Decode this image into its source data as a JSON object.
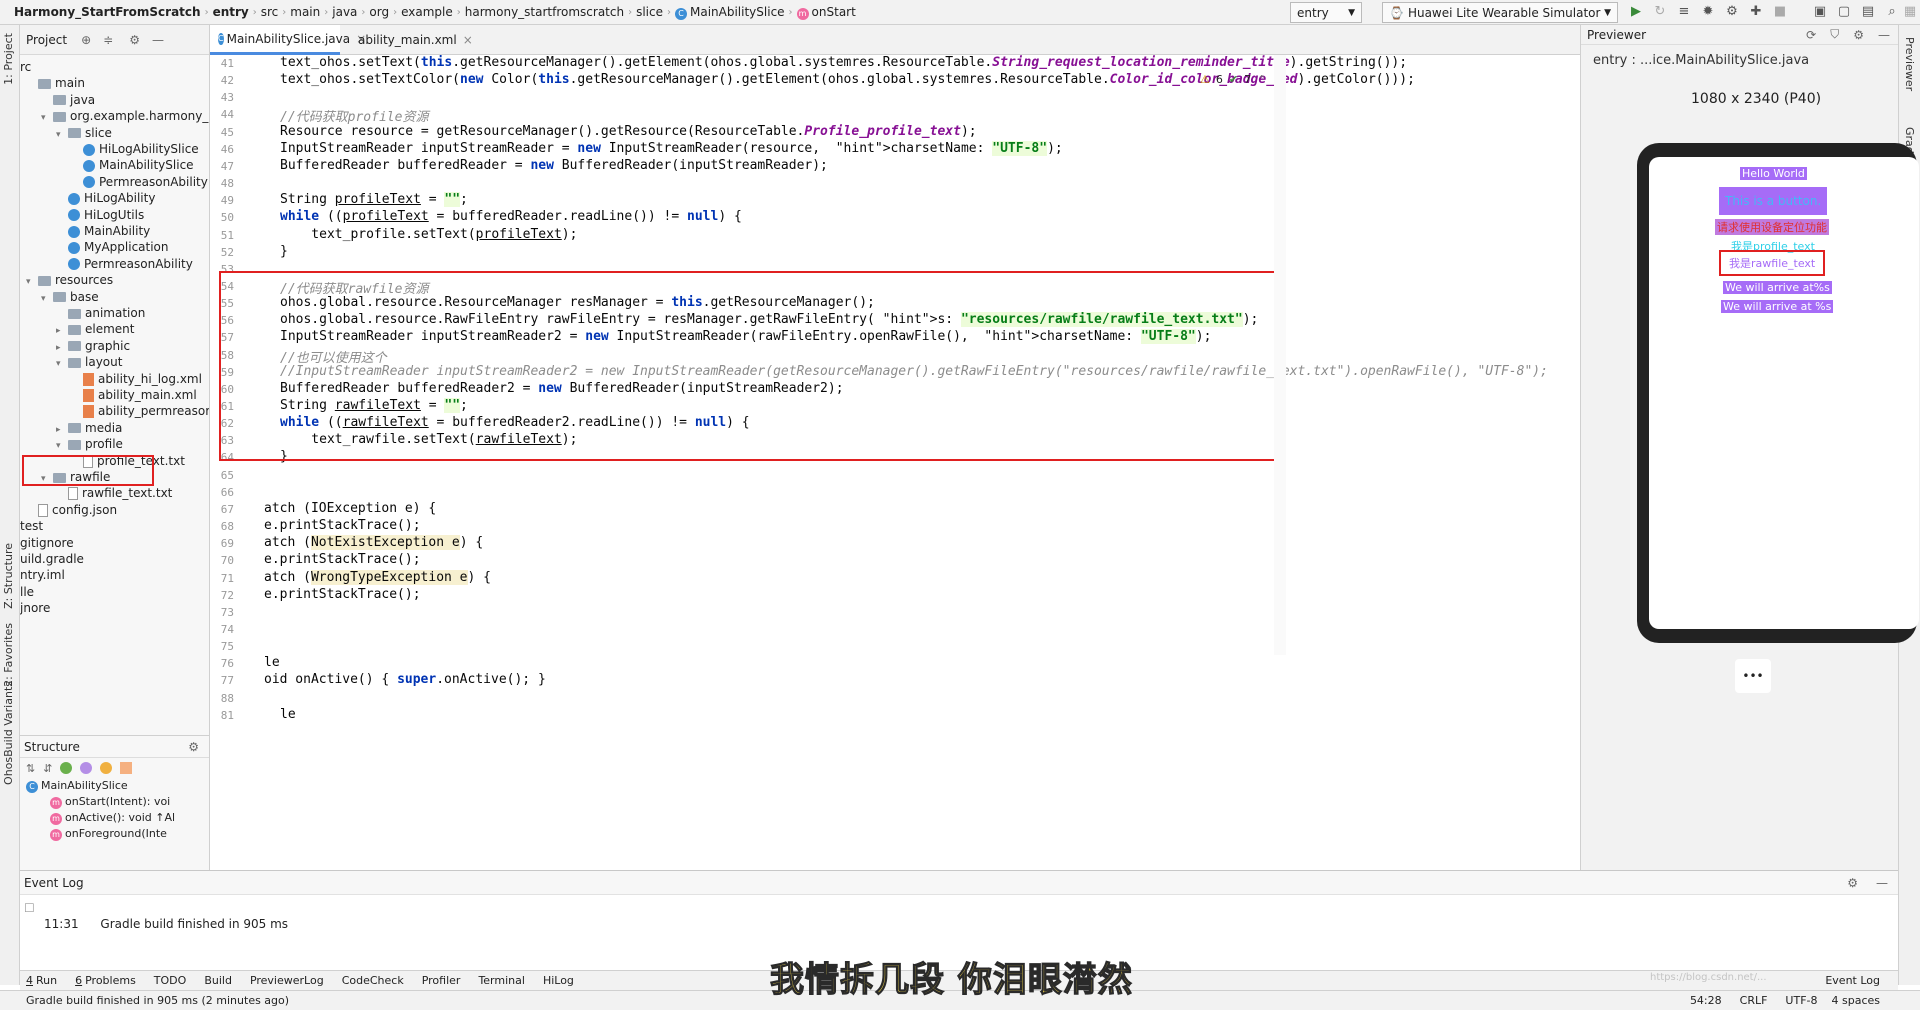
{
  "breadcrumb": [
    "Harmony_StartFromScratch",
    "entry",
    "src",
    "main",
    "java",
    "org",
    "example",
    "harmony_startfromscratch",
    "slice",
    "MainAbilitySlice",
    "onStart"
  ],
  "toolbar": {
    "config": "entry",
    "device": "Huawei Lite Wearable Simulator"
  },
  "left_tabs": {
    "project": "1: Project",
    "structure": "Z: Structure",
    "favorites": "2: Favorites",
    "ohos": "OhosBuild Variants"
  },
  "right_tabs": {
    "previewer": "Previewer",
    "gradle": "Gradle"
  },
  "project": {
    "title": "Project",
    "nodes": [
      {
        "label": "rc",
        "icon": "none",
        "indent": 0,
        "arrow": ""
      },
      {
        "label": "main",
        "icon": "folder",
        "indent": 0,
        "arrow": ""
      },
      {
        "label": "java",
        "icon": "folder",
        "indent": 1,
        "arrow": ""
      },
      {
        "label": "org.example.harmony_st",
        "icon": "folder",
        "indent": 1,
        "arrow": "down"
      },
      {
        "label": "slice",
        "icon": "folder",
        "indent": 2,
        "arrow": "down"
      },
      {
        "label": "HiLogAbilitySlice",
        "icon": "class",
        "indent": 3,
        "arrow": ""
      },
      {
        "label": "MainAbilitySlice",
        "icon": "class",
        "indent": 3,
        "arrow": ""
      },
      {
        "label": "PermreasonAbility",
        "icon": "class",
        "indent": 3,
        "arrow": ""
      },
      {
        "label": "HiLogAbility",
        "icon": "class",
        "indent": 2,
        "arrow": ""
      },
      {
        "label": "HiLogUtils",
        "icon": "class",
        "indent": 2,
        "arrow": ""
      },
      {
        "label": "MainAbility",
        "icon": "class",
        "indent": 2,
        "arrow": ""
      },
      {
        "label": "MyApplication",
        "icon": "class",
        "indent": 2,
        "arrow": ""
      },
      {
        "label": "PermreasonAbility",
        "icon": "class",
        "indent": 2,
        "arrow": ""
      },
      {
        "label": "resources",
        "icon": "folder",
        "indent": 0,
        "arrow": "down"
      },
      {
        "label": "base",
        "icon": "folder",
        "indent": 1,
        "arrow": "down"
      },
      {
        "label": "animation",
        "icon": "folder",
        "indent": 2,
        "arrow": ""
      },
      {
        "label": "element",
        "icon": "folder",
        "indent": 2,
        "arrow": "right"
      },
      {
        "label": "graphic",
        "icon": "folder",
        "indent": 2,
        "arrow": "right"
      },
      {
        "label": "layout",
        "icon": "folder",
        "indent": 2,
        "arrow": "down"
      },
      {
        "label": "ability_hi_log.xml",
        "icon": "xml",
        "indent": 3,
        "arrow": ""
      },
      {
        "label": "ability_main.xml",
        "icon": "xml",
        "indent": 3,
        "arrow": ""
      },
      {
        "label": "ability_permreasor",
        "icon": "xml",
        "indent": 3,
        "arrow": ""
      },
      {
        "label": "media",
        "icon": "folder",
        "indent": 2,
        "arrow": "right"
      },
      {
        "label": "profile",
        "icon": "folder",
        "indent": 2,
        "arrow": "down"
      },
      {
        "label": "profile_text.txt",
        "icon": "txt",
        "indent": 3,
        "arrow": ""
      },
      {
        "label": "rawfile",
        "icon": "folder",
        "indent": 1,
        "arrow": "down"
      },
      {
        "label": "rawfile_text.txt",
        "icon": "txt",
        "indent": 2,
        "arrow": ""
      },
      {
        "label": "config.json",
        "icon": "txt",
        "indent": 0,
        "arrow": ""
      },
      {
        "label": "test",
        "icon": "none",
        "indent": 0,
        "arrow": ""
      },
      {
        "label": "gitignore",
        "icon": "none",
        "indent": 0,
        "arrow": ""
      },
      {
        "label": "uild.gradle",
        "icon": "none",
        "indent": 0,
        "arrow": ""
      },
      {
        "label": "ntry.iml",
        "icon": "none",
        "indent": 0,
        "arrow": ""
      },
      {
        "label": "lle",
        "icon": "none",
        "indent": 0,
        "arrow": ""
      },
      {
        "label": "jnore",
        "icon": "none",
        "indent": 0,
        "arrow": ""
      }
    ]
  },
  "structure": {
    "title": "Structure",
    "items": [
      {
        "label": "MainAbilitySlice",
        "kind": "class"
      },
      {
        "label": "onStart(Intent): voi",
        "kind": "method"
      },
      {
        "label": "onActive(): void ↑Al",
        "kind": "method"
      },
      {
        "label": "onForeground(Inte",
        "kind": "method"
      }
    ]
  },
  "editor_tabs": [
    {
      "label": "MainAbilitySlice.java",
      "active": true
    },
    {
      "label": "ability_main.xml",
      "active": false
    }
  ],
  "inspection": {
    "warnings": "6",
    "ok": "7"
  },
  "line_numbers": [
    "41",
    "42",
    "43",
    "44",
    "45",
    "46",
    "47",
    "48",
    "49",
    "50",
    "51",
    "52",
    "53",
    "54",
    "55",
    "56",
    "57",
    "58",
    "59",
    "60",
    "61",
    "62",
    "63",
    "64",
    "65",
    "66",
    "67",
    "68",
    "69",
    "70",
    "71",
    "72",
    "73",
    "74",
    "75",
    "76",
    "77",
    "88",
    "81"
  ],
  "code_lines": [
    "text_ohos.setText(this.getResourceManager().getElement(ohos.global.systemres.ResourceTable.String_request_location_reminder_title).getString());",
    "text_ohos.setTextColor(new Color(this.getResourceManager().getElement(ohos.global.systemres.ResourceTable.Color_id_color_badge_red).getColor()));",
    "",
    "//代码获取profile资源",
    "Resource resource = getResourceManager().getResource(ResourceTable.Profile_profile_text);",
    "InputStreamReader inputStreamReader = new InputStreamReader(resource,  charsetName: \"UTF-8\");",
    "BufferedReader bufferedReader = new BufferedReader(inputStreamReader);",
    "",
    "String profileText = \"\";",
    "while ((profileText = bufferedReader.readLine()) != null) {",
    "    text_profile.setText(profileText);",
    "}",
    "",
    "//代码获取rawfile资源",
    "ohos.global.resource.ResourceManager resManager = this.getResourceManager();",
    "ohos.global.resource.RawFileEntry rawFileEntry = resManager.getRawFileEntry( s: \"resources/rawfile/rawfile_text.txt\");",
    "InputStreamReader inputStreamReader2 = new InputStreamReader(rawFileEntry.openRawFile(),  charsetName: \"UTF-8\");",
    "//也可以使用这个",
    "//InputStreamReader inputStreamReader2 = new InputStreamReader(getResourceManager().getRawFileEntry(\"resources/rawfile/rawfile_text.txt\").openRawFile(), \"UTF-8\");",
    "BufferedReader bufferedReader2 = new BufferedReader(inputStreamReader2);",
    "String rawfileText = \"\";",
    "while ((rawfileText = bufferedReader2.readLine()) != null) {",
    "    text_rawfile.setText(rawfileText);",
    "}",
    "",
    "",
    "atch (IOException e) {",
    "e.printStackTrace();",
    "atch (NotExistException e) {",
    "e.printStackTrace();",
    "atch (WrongTypeException e) {",
    "e.printStackTrace();",
    "",
    "",
    "",
    "le",
    "oid onActive() { super.onActive(); }",
    "",
    "le"
  ],
  "previewer": {
    "title": "Previewer",
    "file": "entry : ...ice.MainAbilitySlice.java",
    "resolution": "1080 x 2340 (P40)",
    "screen_texts": {
      "hello": "Hello World",
      "button": "This is a button.",
      "location": "请求使用设备定位功能",
      "profile": "我是profile_text",
      "rawfile": "我是rawfile_text",
      "arrive1": "We will arrive at%s",
      "arrive2": "We will arrive at %s"
    },
    "more": "•••"
  },
  "event_log": {
    "title": "Event Log",
    "time": "11:31",
    "message": "Gradle build finished in 905 ms"
  },
  "bottom_tabs": [
    {
      "num": "4",
      "label": "Run"
    },
    {
      "num": "6",
      "label": "Problems"
    },
    {
      "num": "",
      "label": "TODO"
    },
    {
      "num": "",
      "label": "Build"
    },
    {
      "num": "",
      "label": "PreviewerLog"
    },
    {
      "num": "",
      "label": "CodeCheck"
    },
    {
      "num": "",
      "label": "Profiler"
    },
    {
      "num": "",
      "label": "Terminal"
    },
    {
      "num": "",
      "label": "HiLog"
    }
  ],
  "event_log_tab": "Event Log",
  "status": {
    "message": "Gradle build finished in 905 ms (2 minutes ago)",
    "position": "54:28",
    "line_sep": "CRLF",
    "encoding": "UTF-8",
    "indent": "4 spaces"
  },
  "overlay_subtitle": "我情拆几段 你泪眼潸然",
  "watermark": "https://blog.csdn.net/...",
  "colors": {
    "accent": "#4a8be0",
    "highlight_box": "#e02020",
    "preview_purple": "#a66cf7"
  }
}
